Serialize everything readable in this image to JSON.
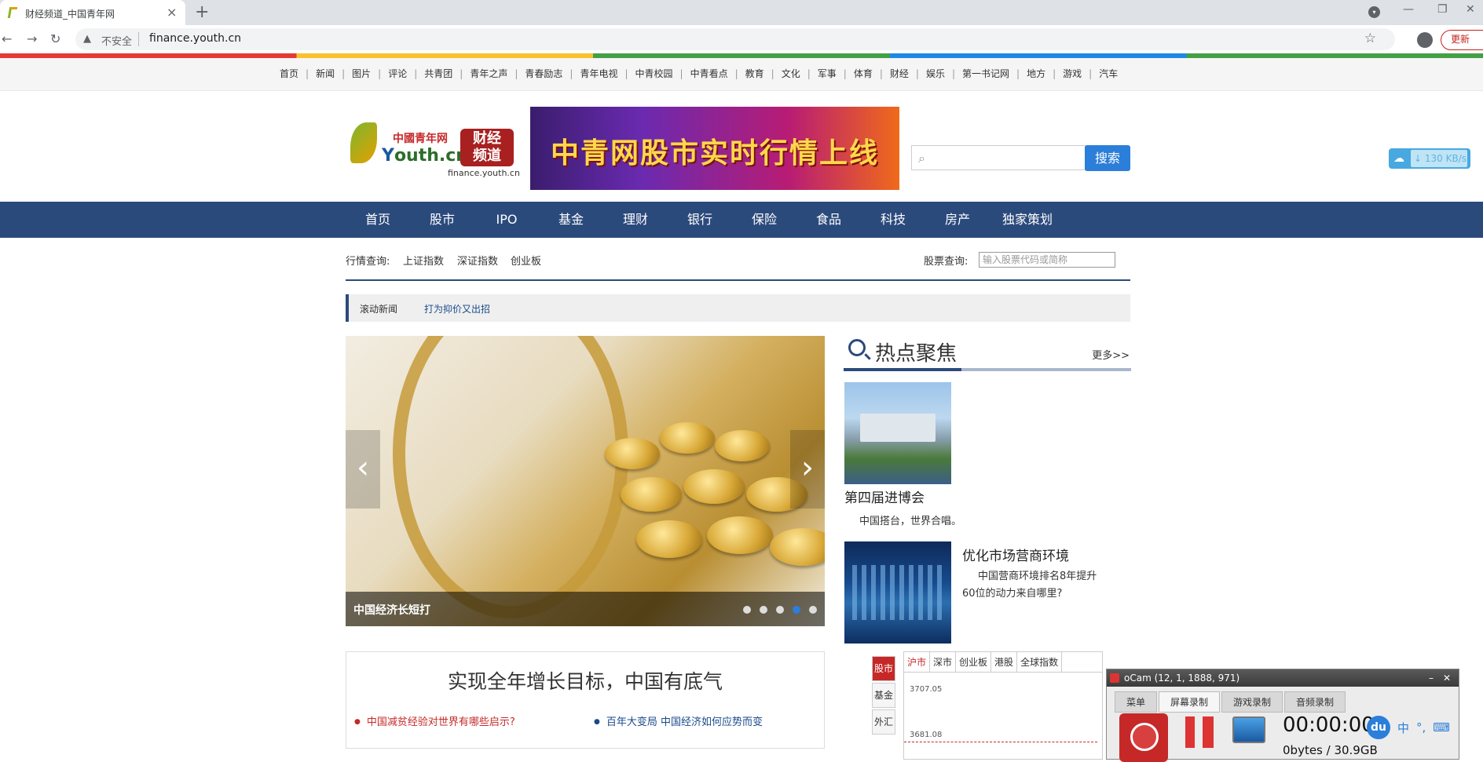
{
  "browser": {
    "tab_title": "财经频道_中国青年网",
    "tab_close": "×",
    "new_tab": "+",
    "not_secure": "不安全",
    "url": "finance.youth.cn",
    "update_label": "更新"
  },
  "topnav": [
    "首页",
    "新闻",
    "图片",
    "评论",
    "共青团",
    "青年之声",
    "青春励志",
    "青年电视",
    "中青校园",
    "中青看点",
    "教育",
    "文化",
    "军事",
    "体育",
    "财经",
    "娱乐",
    "第一书记网",
    "地方",
    "游戏",
    "汽车"
  ],
  "logo": {
    "cn_site": "中國青年网",
    "youth_y": "Y",
    "youth_rest": "outh.cn",
    "channel": "财经\n频道",
    "domain": "finance.youth.cn"
  },
  "banner": {
    "text": "中青网股市实时行情上线"
  },
  "search": {
    "button": "搜索"
  },
  "speed": {
    "text": "130 KB/s"
  },
  "mainnav": [
    "首页",
    "股市",
    "IPO",
    "基金",
    "理财",
    "银行",
    "保险",
    "食品",
    "科技",
    "房产",
    "独家策划"
  ],
  "query": {
    "label": "行情查询:",
    "links": [
      "上证指数",
      "深证指数",
      "创业板"
    ],
    "stock_label": "股票查询:",
    "stock_placeholder": "输入股票代码或简称"
  },
  "scrollnews": {
    "label": "滚动新闻",
    "text": "打为抑价又出招"
  },
  "carousel": {
    "caption": "中国经济长短打",
    "prev": "‹",
    "next": "›",
    "active_index": 3,
    "slides": 5
  },
  "hot": {
    "title": "热点聚焦",
    "more": "更多>>",
    "item1_title": "第四届进博会",
    "item1_desc": "中国搭台，世界合唱。",
    "item2_title": "优化市场营商环境",
    "item2_desc": "中国营商环境排名8年提升60位的动力来自哪里?"
  },
  "headline": {
    "title": "实现全年增长目标，中国有底气",
    "link1": "中国减贫经验对世界有哪些启示?",
    "link2": "百年大变局 中国经济如何应势而变"
  },
  "stock": {
    "side_tabs": [
      "股市",
      "基金",
      "外汇"
    ],
    "tabs": [
      "沪市",
      "深市",
      "创业板",
      "港股",
      "全球指数"
    ],
    "value_top": "3707.05",
    "value_bottom": "3681.08"
  },
  "ocam": {
    "title": "oCam (12, 1, 1888, 971)",
    "min": "–",
    "close": "✕",
    "tabs": [
      "菜单",
      "屏幕录制",
      "游戏录制",
      "音频录制"
    ],
    "time": "00:00:00",
    "size": "0bytes / 30.9GB"
  },
  "ime": {
    "logo": "du",
    "lang": "中",
    "punct": "°,"
  }
}
